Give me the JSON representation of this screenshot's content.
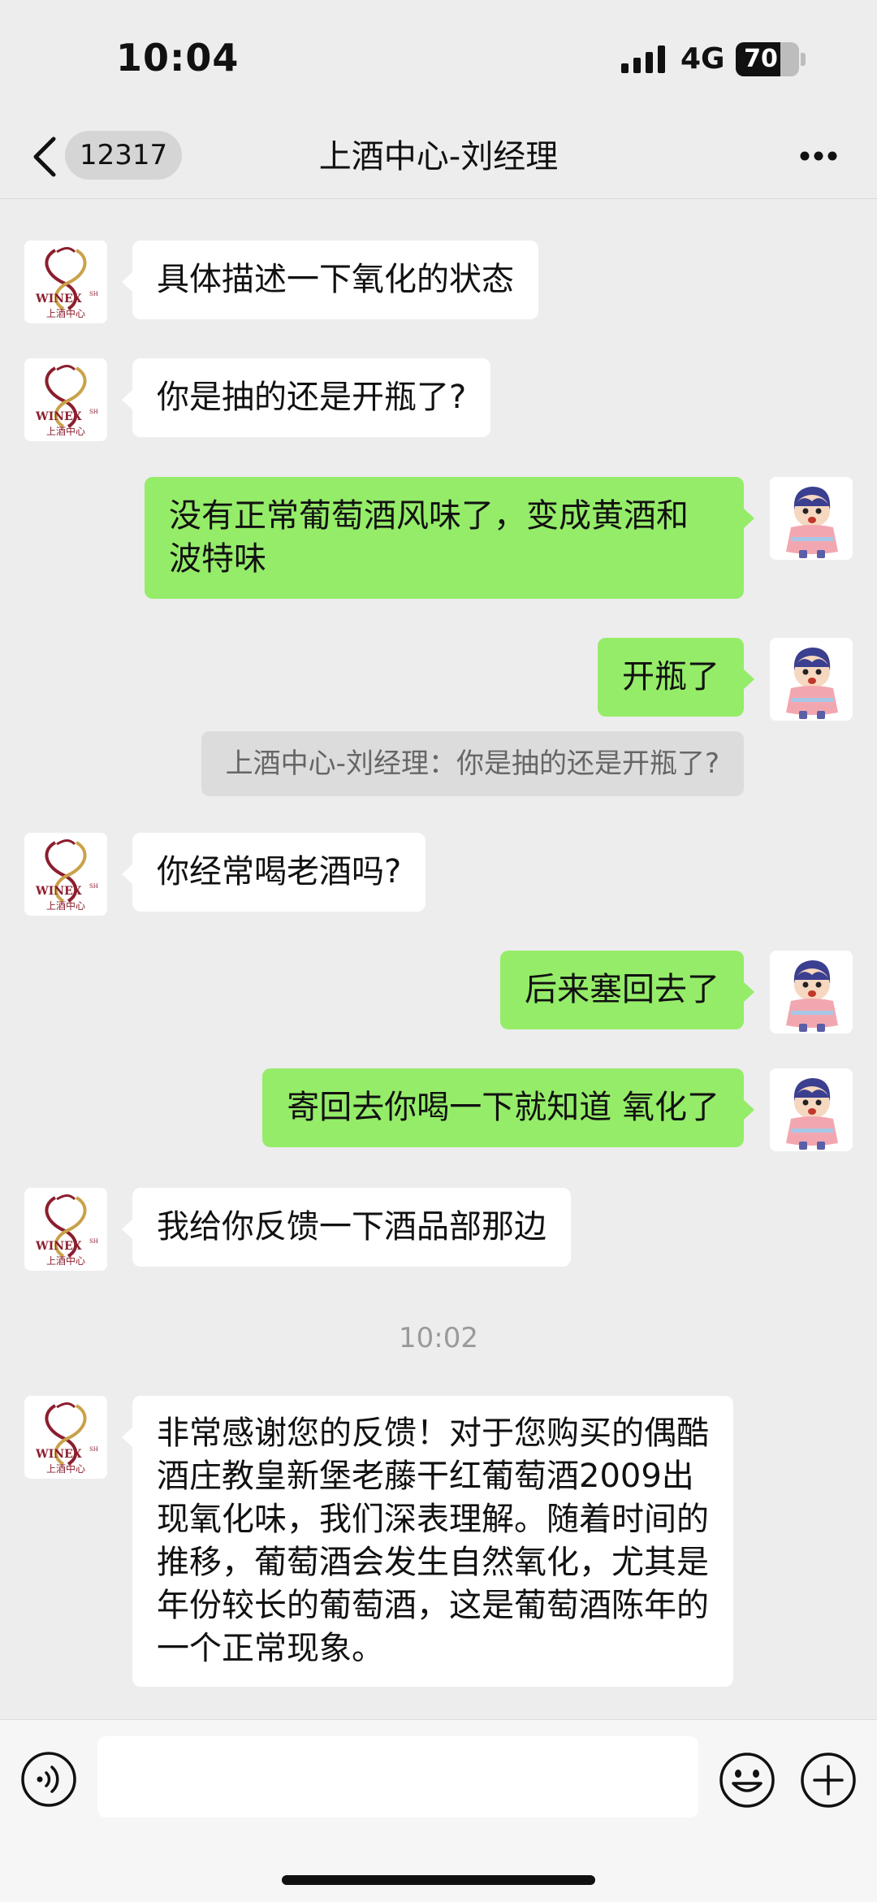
{
  "status_bar": {
    "time": "10:04",
    "network": "4G",
    "battery_level": "70",
    "battery_fraction": 0.7
  },
  "nav": {
    "unread_count": "12317",
    "title": "上酒中心-刘经理"
  },
  "avatar_text": {
    "brand": "WINEX",
    "brand_sup": "SH",
    "subtitle": "上酒中心"
  },
  "messages": [
    {
      "text": "具体描述一下氧化的状态"
    },
    {
      "text": "你是抽的还是开瓶了?"
    },
    {
      "text": "没有正常葡萄酒风味了，变成黄酒和波特味"
    },
    {
      "text": "开瓶了"
    },
    {
      "text": "上酒中心-刘经理：你是抽的还是开瓶了?"
    },
    {
      "text": "你经常喝老酒吗?"
    },
    {
      "text": "后来塞回去了"
    },
    {
      "text": "寄回去你喝一下就知道 氧化了"
    },
    {
      "text": "我给你反馈一下酒品部那边"
    },
    {
      "text": "10:02"
    },
    {
      "text": "非常感谢您的反馈！对于您购买的偶酷酒庄教皇新堡老藤干红葡萄酒2009出现氧化味，我们深表理解。随着时间的推移，葡萄酒会发生自然氧化，尤其是年份较长的葡萄酒，这是葡萄酒陈年的一个正常现象。"
    }
  ],
  "input": {
    "value": "",
    "placeholder": ""
  },
  "colors": {
    "background": "#ededed",
    "outgoing_bubble": "#95ec69",
    "incoming_bubble": "#ffffff",
    "quote_bg": "#dcdcdc"
  }
}
